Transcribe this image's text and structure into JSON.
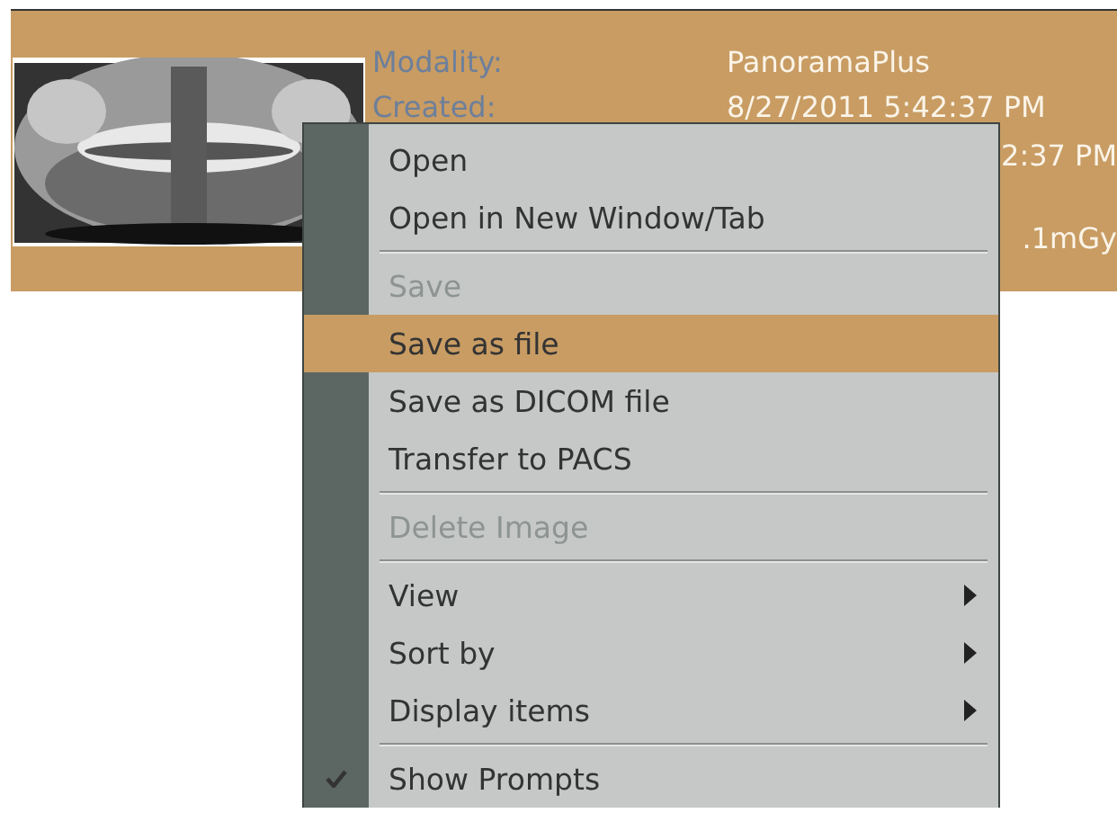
{
  "image_card": {
    "fields": [
      {
        "label": "Modality:",
        "value": "PanoramaPlus"
      },
      {
        "label": "Created:",
        "value": "8/27/2011 5:42:37 PM"
      }
    ],
    "partial_values": [
      "2:37 PM",
      ".1mGy"
    ]
  },
  "context_menu": {
    "items": [
      {
        "kind": "item",
        "label": "Open",
        "disabled": false,
        "selected": false,
        "checked": false,
        "submenu": false
      },
      {
        "kind": "item",
        "label": "Open in New Window/Tab",
        "disabled": false,
        "selected": false,
        "checked": false,
        "submenu": false
      },
      {
        "kind": "separator"
      },
      {
        "kind": "item",
        "label": "Save",
        "disabled": true,
        "selected": false,
        "checked": false,
        "submenu": false
      },
      {
        "kind": "item",
        "label": "Save as file",
        "disabled": false,
        "selected": true,
        "checked": false,
        "submenu": false
      },
      {
        "kind": "item",
        "label": "Save as DICOM file",
        "disabled": false,
        "selected": false,
        "checked": false,
        "submenu": false
      },
      {
        "kind": "item",
        "label": "Transfer to PACS",
        "disabled": false,
        "selected": false,
        "checked": false,
        "submenu": false
      },
      {
        "kind": "separator"
      },
      {
        "kind": "item",
        "label": "Delete Image",
        "disabled": true,
        "selected": false,
        "checked": false,
        "submenu": false
      },
      {
        "kind": "separator"
      },
      {
        "kind": "item",
        "label": "View",
        "disabled": false,
        "selected": false,
        "checked": false,
        "submenu": true
      },
      {
        "kind": "item",
        "label": "Sort by",
        "disabled": false,
        "selected": false,
        "checked": false,
        "submenu": true
      },
      {
        "kind": "item",
        "label": "Display items",
        "disabled": false,
        "selected": false,
        "checked": false,
        "submenu": true
      },
      {
        "kind": "separator"
      },
      {
        "kind": "item",
        "label": "Show Prompts",
        "disabled": false,
        "selected": false,
        "checked": true,
        "submenu": false
      }
    ]
  }
}
